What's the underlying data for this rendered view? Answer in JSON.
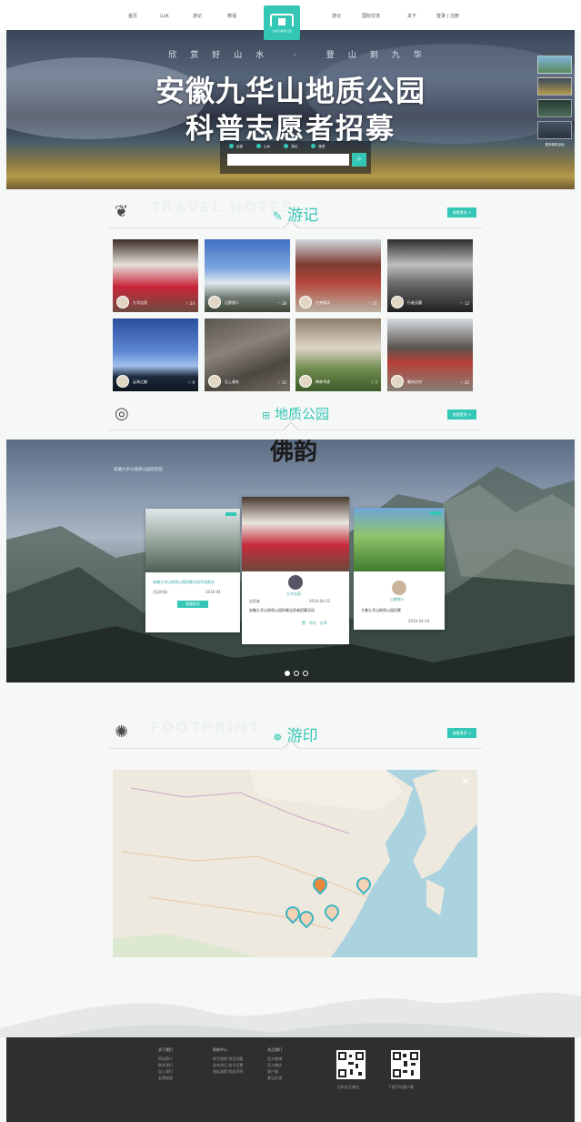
{
  "nav": {
    "left": [
      "首页",
      "山水",
      "游记",
      "微语"
    ],
    "right": [
      "游记",
      "国际交流",
      "关于",
      "登录 | 注册"
    ],
    "logo_caption": "九华山地质公园"
  },
  "hero": {
    "slogan": "欣赏好山水 · 登山到九华",
    "title1": "安徽九华山地质公园",
    "title2": "科普志愿者招募",
    "search_options": [
      "全部",
      "山水",
      "游记",
      "微语"
    ],
    "search_placeholder": "",
    "search_button": "⌕",
    "thumb_caption": "更多精彩活动"
  },
  "youji": {
    "ghost": "TRAVEL NOTES",
    "title": "游记",
    "more": "查看更多 >",
    "tiles": [
      {
        "name": "九华志愿",
        "likes": "♡ 24"
      },
      {
        "name": "山野旅人",
        "likes": "♡ 18"
      },
      {
        "name": "古寺探访",
        "likes": "♡ 31"
      },
      {
        "name": "行者无疆",
        "likes": "♡ 12"
      },
      {
        "name": "云海之巅",
        "likes": "♡ 9"
      },
      {
        "name": "石上春秋",
        "likes": "♡ 15"
      },
      {
        "name": "碑林寻迹",
        "likes": "♡ 7"
      },
      {
        "name": "徽州古村",
        "likes": "♡ 22"
      }
    ]
  },
  "geopark": {
    "title": "地质公园",
    "more": "查看更多 >",
    "subtitle": "安徽九华山地质公园欢迎您",
    "calligraphy": "佛韵",
    "cards": [
      {
        "title": "安徽九华山地质公园科普活动开始报名",
        "date": "活动时间",
        "meta": "2016-04",
        "button": "我要报名"
      },
      {
        "user": "九华志愿",
        "role": "志愿者",
        "date": "2016-04-22",
        "text": "安徽九华山地质公园科普志愿者招募活动",
        "actions": "赞 · 评论 · 分享"
      },
      {
        "user": "山野旅人",
        "text": "大美九华山地质公园风景",
        "date": "2016-04-20"
      }
    ]
  },
  "zuji": {
    "ghost": "FOOTPRINT",
    "title": "游印",
    "more": "查看更多 >"
  },
  "footer": {
    "cols": [
      {
        "head": "关于我们",
        "items": [
          "网站简介",
          "联系我们",
          "加入我们",
          "友情链接"
        ]
      },
      {
        "head": "帮助中心",
        "items": [
          "新手指南  常见问题",
          "发布游记  账号设置",
          "隐私政策  版权声明"
        ]
      },
      {
        "head": "关注我们",
        "items": [
          "官方微博",
          "官方微信",
          "客户端",
          "意见反馈"
        ]
      }
    ],
    "qr1": "扫码关注微信",
    "qr2": "下载手机客户端"
  }
}
